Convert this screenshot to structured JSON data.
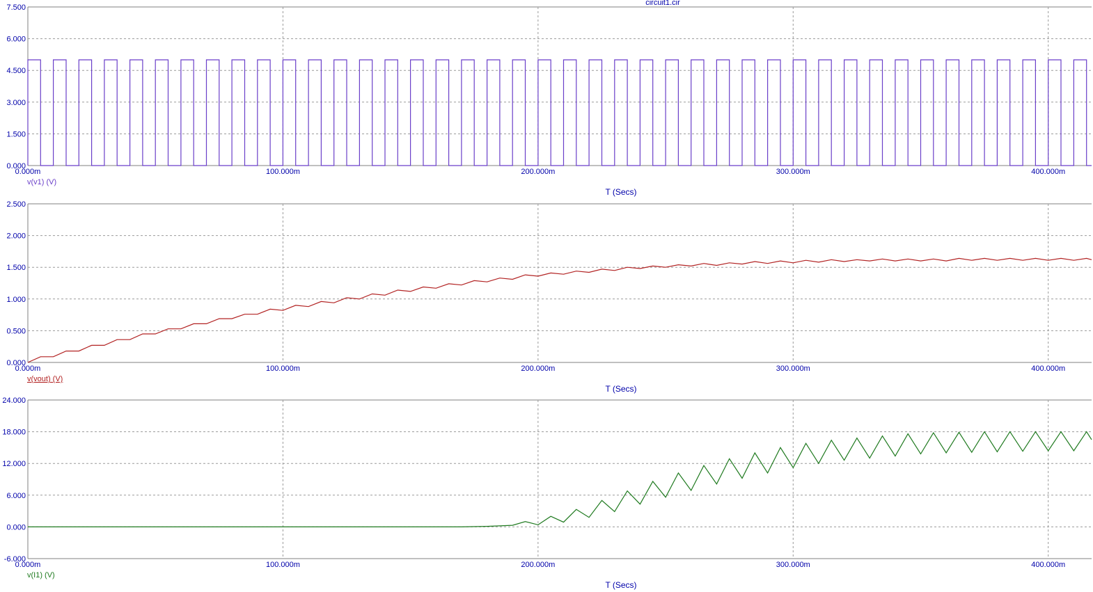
{
  "title": "circuit1.cir",
  "chart_data": [
    {
      "type": "line",
      "series": [
        {
          "name": "v(v1) (V)",
          "color": "#6a3fc9"
        }
      ],
      "waveform": {
        "kind": "square",
        "low": 0,
        "high": 5,
        "period_ms": 10,
        "high_from_ms": 0,
        "high_to_ms": 5
      },
      "ylim": [
        0,
        7.5
      ],
      "yticks": [
        "0.000",
        "1.500",
        "3.000",
        "4.500",
        "6.000",
        "7.500"
      ],
      "xlim_ms": [
        0,
        417
      ],
      "xticks": [
        "0.000m",
        "100.000m",
        "200.000m",
        "300.000m",
        "400.000m"
      ],
      "xlabel": "T (Secs)",
      "grid": true
    },
    {
      "type": "line",
      "series": [
        {
          "name": "v(vout) (V)",
          "color": "#b22222",
          "x_ms": [
            0,
            5,
            10,
            15,
            20,
            25,
            30,
            35,
            40,
            45,
            50,
            55,
            60,
            65,
            70,
            75,
            80,
            85,
            90,
            95,
            100,
            105,
            110,
            115,
            120,
            125,
            130,
            135,
            140,
            145,
            150,
            155,
            160,
            165,
            170,
            175,
            180,
            185,
            190,
            195,
            200,
            205,
            210,
            215,
            220,
            225,
            230,
            235,
            240,
            245,
            250,
            255,
            260,
            265,
            270,
            275,
            280,
            285,
            290,
            295,
            300,
            305,
            310,
            315,
            320,
            325,
            330,
            335,
            340,
            345,
            350,
            355,
            360,
            365,
            370,
            375,
            380,
            385,
            390,
            395,
            400,
            405,
            410,
            415,
            417
          ],
          "y": [
            0,
            0.09,
            0.09,
            0.18,
            0.18,
            0.27,
            0.27,
            0.36,
            0.36,
            0.45,
            0.45,
            0.53,
            0.53,
            0.61,
            0.61,
            0.69,
            0.69,
            0.76,
            0.76,
            0.84,
            0.82,
            0.9,
            0.88,
            0.96,
            0.94,
            1.02,
            1.0,
            1.08,
            1.06,
            1.14,
            1.12,
            1.19,
            1.17,
            1.24,
            1.22,
            1.29,
            1.27,
            1.33,
            1.31,
            1.38,
            1.36,
            1.41,
            1.39,
            1.44,
            1.42,
            1.47,
            1.45,
            1.5,
            1.48,
            1.52,
            1.5,
            1.54,
            1.52,
            1.56,
            1.53,
            1.57,
            1.55,
            1.59,
            1.56,
            1.6,
            1.57,
            1.61,
            1.58,
            1.62,
            1.59,
            1.62,
            1.6,
            1.63,
            1.6,
            1.63,
            1.6,
            1.63,
            1.6,
            1.64,
            1.61,
            1.64,
            1.61,
            1.64,
            1.61,
            1.64,
            1.61,
            1.64,
            1.61,
            1.64,
            1.62
          ]
        }
      ],
      "ylim": [
        0,
        2.5
      ],
      "yticks": [
        "0.000",
        "0.500",
        "1.000",
        "1.500",
        "2.000",
        "2.500"
      ],
      "xlim_ms": [
        0,
        417
      ],
      "xticks": [
        "0.000m",
        "100.000m",
        "200.000m",
        "300.000m",
        "400.000m"
      ],
      "xlabel": "T (Secs)",
      "grid": true
    },
    {
      "type": "line",
      "series": [
        {
          "name": "v(I1) (V)",
          "color": "#1f7a1f",
          "x_ms": [
            0,
            170,
            175,
            180,
            185,
            190,
            195,
            200,
            205,
            210,
            215,
            220,
            225,
            230,
            235,
            240,
            245,
            250,
            255,
            260,
            265,
            270,
            275,
            280,
            285,
            290,
            295,
            300,
            305,
            310,
            315,
            320,
            325,
            330,
            335,
            340,
            345,
            350,
            355,
            360,
            365,
            370,
            375,
            380,
            385,
            390,
            395,
            400,
            405,
            410,
            415,
            417
          ],
          "y": [
            0,
            0,
            0.05,
            0.1,
            0.2,
            0.3,
            1.0,
            0.4,
            2.0,
            0.9,
            3.3,
            1.8,
            5.0,
            2.9,
            6.8,
            4.3,
            8.6,
            5.6,
            10.2,
            6.9,
            11.6,
            8.1,
            12.9,
            9.2,
            14.0,
            10.2,
            15.0,
            11.2,
            15.8,
            12.0,
            16.4,
            12.6,
            16.8,
            13.0,
            17.2,
            13.4,
            17.6,
            13.8,
            17.8,
            14.0,
            17.9,
            14.1,
            18.0,
            14.2,
            18.0,
            14.3,
            18.0,
            14.4,
            18.0,
            14.4,
            18.0,
            16.5
          ]
        }
      ],
      "ylim": [
        -6,
        24
      ],
      "yticks": [
        "-6.000",
        "0.000",
        "6.000",
        "12.000",
        "18.000",
        "24.000"
      ],
      "xlim_ms": [
        0,
        417
      ],
      "xticks": [
        "0.000m",
        "100.000m",
        "200.000m",
        "300.000m",
        "400.000m"
      ],
      "xlabel": "T (Secs)",
      "grid": true
    }
  ]
}
